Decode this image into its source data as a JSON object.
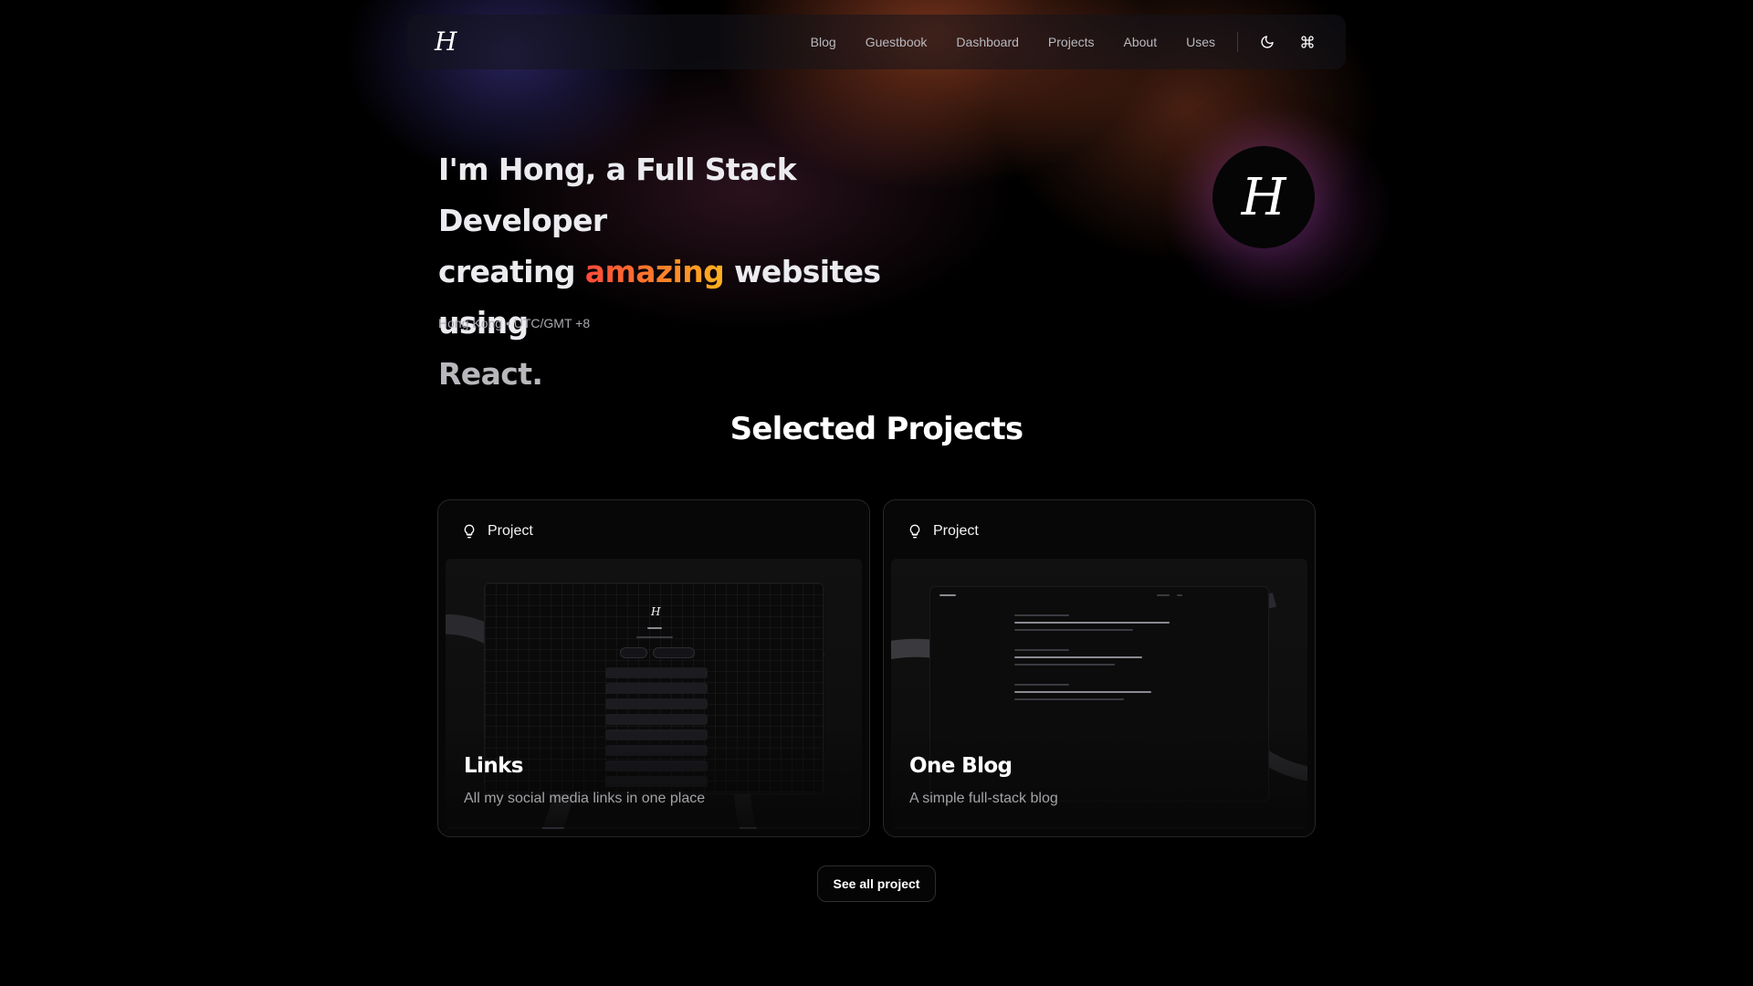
{
  "header": {
    "logo": "H",
    "nav": [
      "Blog",
      "Guestbook",
      "Dashboard",
      "Projects",
      "About",
      "Uses"
    ],
    "theme_icon": "moon-icon",
    "command_icon": "command-icon"
  },
  "hero": {
    "line1": "I'm Hong, a Full Stack Developer",
    "line2_before": "creating ",
    "line2_highlight": "amazing",
    "line2_after": " websites using",
    "line3": "React.",
    "location": "Hong Kong • UTC/GMT +8",
    "avatar": "H",
    "highlight_colors": [
      "#ff4a3a",
      "#ffb21f"
    ]
  },
  "projects": {
    "title": "Selected Projects",
    "cards": [
      {
        "tag": "Project",
        "title": "Links",
        "description": "All my social media links in one place"
      },
      {
        "tag": "Project",
        "title": "One Blog",
        "description": "A simple full-stack blog"
      }
    ],
    "see_all": "See all project"
  }
}
